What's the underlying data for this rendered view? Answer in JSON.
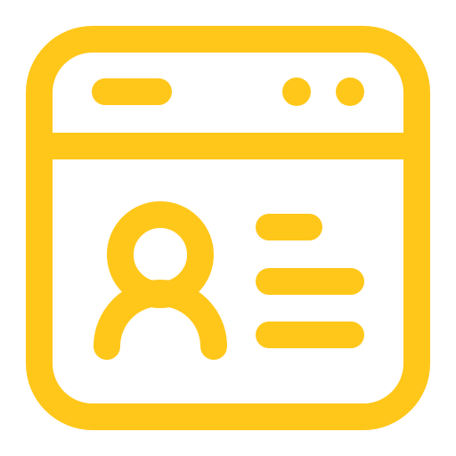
{
  "icon": {
    "name": "browser-profile-icon",
    "color": "#FFC71A",
    "background": "#FFFFFF"
  }
}
